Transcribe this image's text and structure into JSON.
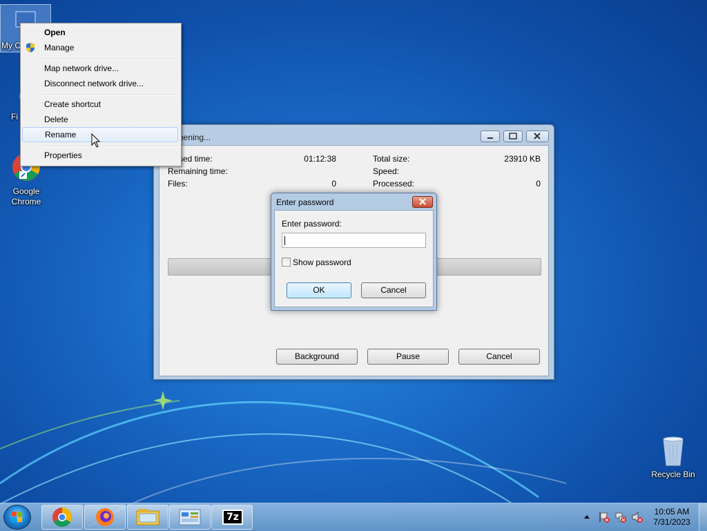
{
  "desktop": {
    "icons": [
      {
        "label": "My C"
      },
      {
        "label": "Fi"
      },
      {
        "label": "Google Chrome"
      },
      {
        "label": "Recycle Bin"
      }
    ]
  },
  "context_menu": {
    "items": [
      {
        "label": "Open"
      },
      {
        "label": "Manage"
      },
      {
        "label": "Map network drive..."
      },
      {
        "label": "Disconnect network drive..."
      },
      {
        "label": "Create shortcut"
      },
      {
        "label": "Delete"
      },
      {
        "label": "Rename"
      },
      {
        "label": "Properties"
      }
    ]
  },
  "progress_window": {
    "title": "pening...",
    "elapsed_label": "sed time:",
    "elapsed_value": "01:12:38",
    "remaining_label": "Remaining time:",
    "files_label": "Files:",
    "files_value": "0",
    "total_size_label": "Total size:",
    "total_size_value": "23910 KB",
    "speed_label": "Speed:",
    "processed_label": "Processed:",
    "processed_value": "0",
    "buttons": {
      "background": "Background",
      "pause": "Pause",
      "cancel": "Cancel"
    }
  },
  "password_dialog": {
    "title": "Enter password",
    "prompt": "Enter password:",
    "value": "",
    "show_password_label": "Show password",
    "show_password_checked": false,
    "ok": "OK",
    "cancel": "Cancel"
  },
  "taskbar": {
    "apps": [
      {
        "icon": "chrome-icon"
      },
      {
        "icon": "firefox-icon"
      },
      {
        "icon": "explorer-icon"
      },
      {
        "icon": "control-panel-icon"
      },
      {
        "icon": "7zip-icon",
        "text": "7z"
      }
    ],
    "time": "10:05 AM",
    "date": "7/31/2023"
  }
}
